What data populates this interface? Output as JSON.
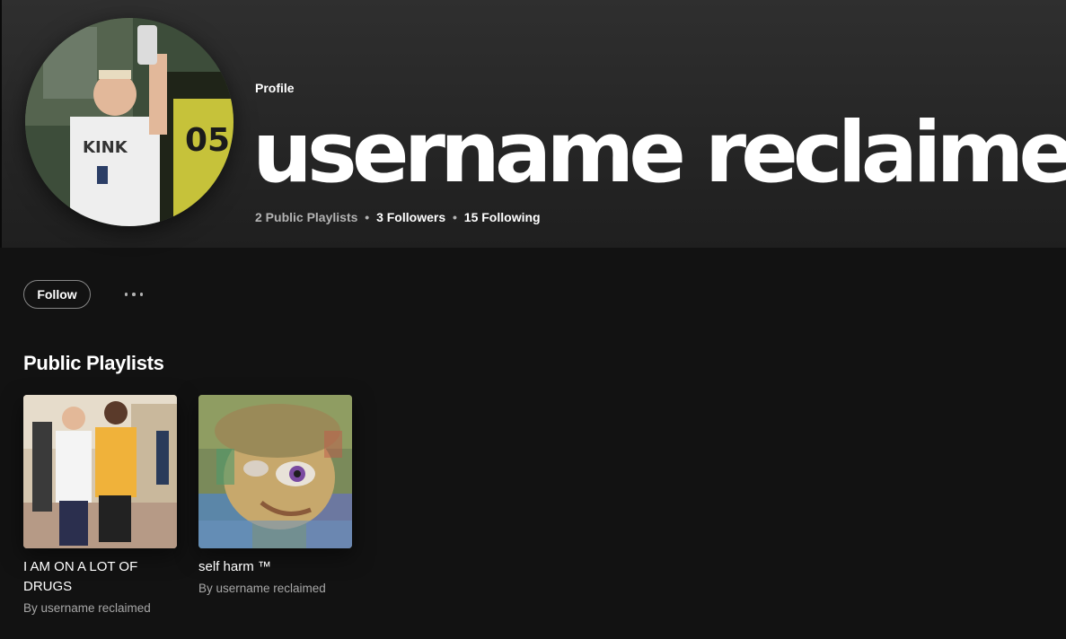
{
  "header": {
    "label": "Profile",
    "display_name": "username reclaimed",
    "stats": {
      "playlists": "2 Public Playlists",
      "followers": "3 Followers",
      "following": "15 Following",
      "separator": "•"
    }
  },
  "actions": {
    "follow_label": "Follow"
  },
  "playlists_section": {
    "title": "Public Playlists",
    "items": [
      {
        "title": "I AM ON A LOT OF DRUGS",
        "subtitle": "By username reclaimed"
      },
      {
        "title": "self harm ™",
        "subtitle": "By username reclaimed"
      }
    ]
  },
  "colors": {
    "background": "#121212",
    "header_top": "#2f2f2f",
    "muted_text": "#b3b3b3",
    "button_border": "#878787"
  }
}
